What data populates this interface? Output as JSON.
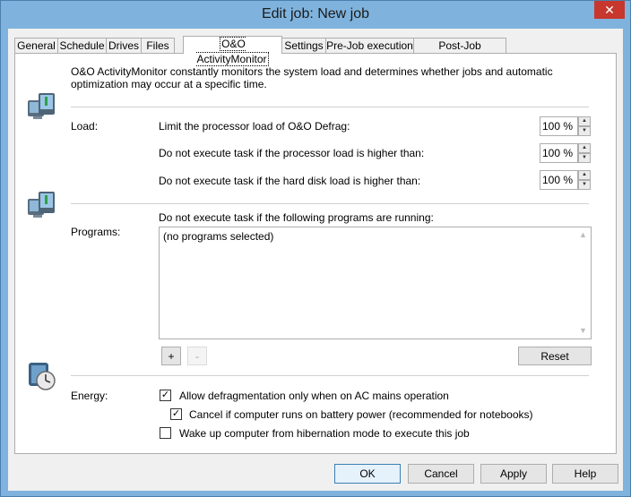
{
  "window": {
    "title": "Edit job: New job",
    "close_glyph": "✕"
  },
  "tabs": [
    {
      "label": "General",
      "active": false
    },
    {
      "label": "Schedule",
      "active": false
    },
    {
      "label": "Drives",
      "active": false
    },
    {
      "label": "Files",
      "active": false
    },
    {
      "label": "O&O ActivityMonitor",
      "active": true
    },
    {
      "label": "Settings",
      "active": false
    },
    {
      "label": "Pre-Job execution",
      "active": false
    },
    {
      "label": "Post-Job execution",
      "active": false
    }
  ],
  "intro_text": "O&O ActivityMonitor constantly monitors the system load and determines whether jobs and automatic optimization may occur at a specific time.",
  "load": {
    "section_label": "Load:",
    "rows": [
      {
        "label": "Limit the processor load of O&O Defrag:",
        "value": "100 %"
      },
      {
        "label": "Do not execute task if the processor load is higher than:",
        "value": "100 %"
      },
      {
        "label": "Do not execute task if the hard disk load is higher than:",
        "value": "100 %"
      }
    ]
  },
  "programs": {
    "caption": "Do not execute task if the following programs are running:",
    "section_label": "Programs:",
    "items": [
      "(no programs selected)"
    ],
    "add_label": "+",
    "remove_label": "-",
    "reset_label": "Reset"
  },
  "energy": {
    "section_label": "Energy:",
    "options": [
      {
        "label": "Allow defragmentation only when on AC mains operation",
        "checked": true
      },
      {
        "label": "Cancel if computer runs on battery power (recommended for notebooks)",
        "checked": true
      },
      {
        "label": "Wake up computer from hibernation mode to execute this job",
        "checked": false
      }
    ]
  },
  "footer": {
    "ok": "OK",
    "cancel": "Cancel",
    "apply": "Apply",
    "help": "Help"
  },
  "icons": {
    "load": "computer-monitor-icon",
    "programs": "computer-monitor-icon",
    "energy": "clock-battery-icon"
  },
  "colors": {
    "title_bar": "#7fb3dd",
    "close_button": "#c7372d",
    "default_button_border": "#3c7fb1"
  }
}
